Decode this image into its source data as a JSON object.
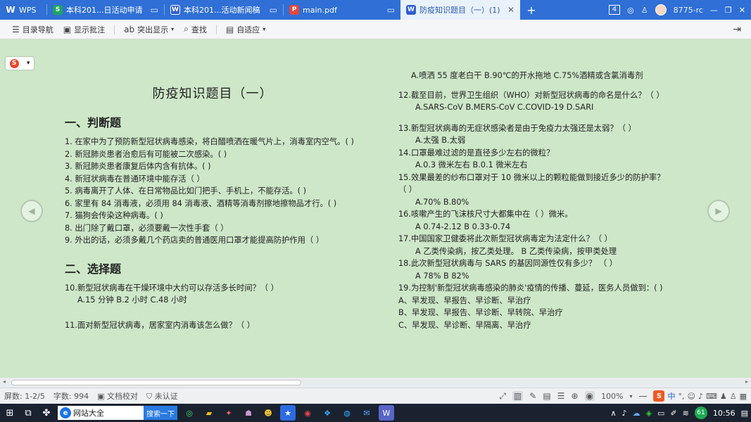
{
  "tabs": [
    {
      "label": "WPS",
      "icon": "wps-logo-icon",
      "color": "#ffffff"
    },
    {
      "label": "本科201...日活动申请",
      "icon": "spreadsheet-icon",
      "color": "#1fa462"
    },
    {
      "label": "本科201...活动新闻稿",
      "icon": "word-doc-icon",
      "color": "#2f5fd0"
    },
    {
      "label": "main.pdf",
      "icon": "pdf-icon",
      "color": "#e5483b"
    },
    {
      "label": "防疫知识题目（一）(1)",
      "icon": "word-doc-icon",
      "color": "#2f5fd0",
      "active": true
    }
  ],
  "titlebar": {
    "tab_count": "4",
    "user": "8775-rc",
    "new_tab": "+"
  },
  "toolbar": {
    "toc": "目录导航",
    "comments": "显示批注",
    "highlight": "突出显示",
    "find": "查找",
    "fit": "自适应"
  },
  "doc": {
    "title": "防疫知识题目（一）",
    "left": [
      {
        "type": "sec",
        "text": "一、判断题"
      },
      {
        "type": "wrap",
        "text": "1.  在家中为了预防新型冠状病毒感染，将白醋喷洒在暖气片上，消毒室内空气。(    )"
      },
      {
        "type": "ln",
        "text": "2.  新冠肺炎患者治愈后有可能被二次感染。(    )"
      },
      {
        "type": "ln",
        "text": "3.  新冠肺炎患者康复后体内含有抗体。(    )"
      },
      {
        "type": "ln",
        "text": "4.  新冠状病毒在普通环境中能存活（    ）"
      },
      {
        "type": "ln",
        "text": "5.  病毒离开了人体、在日常物品比如门把手、手机上，不能存活。(    )"
      },
      {
        "type": "ln",
        "text": "6.  家里有 84 消毒液，必须用 84 消毒液、酒精等消毒剂擦地擦物品才行。(    )"
      },
      {
        "type": "ln",
        "text": "7.  猫狗会传染这种病毒。(    )"
      },
      {
        "type": "ln",
        "text": "8.  出门除了戴口罩，必须要戴一次性手套（    ）"
      },
      {
        "type": "ln",
        "text": "9.  外出的话，必须多戴几个药店卖的普通医用口罩才能提高防护作用（    ）"
      },
      {
        "type": "sec",
        "text": "二、选择题"
      },
      {
        "type": "ln",
        "text": "10.新型冠状病毒在干燥环境中大约可以存活多长时间？（    ）"
      },
      {
        "type": "ind",
        "text": "A.15 分钟  B.2 小时  C.48 小时"
      },
      {
        "type": "ln",
        "text": "11.面对新型冠状病毒，居家室内消毒该怎么做？（    ）"
      }
    ],
    "right": [
      {
        "type": "ind",
        "text": "A.喷洒 55 度老白干  B.90℃的开水拖地  C.75%酒精或含氯消毒剂"
      },
      {
        "type": "ln",
        "text": "12.截至目前，世界卫生组织（WHO）对新型冠状病毒的命名是什么？（    ）"
      },
      {
        "type": "ind2",
        "text": "A.SARS-CoV B.MERS-CoV C.COVID-19 D.SARI"
      },
      {
        "type": "ln",
        "text": "13.新型冠状病毒的无症状感染者是由于免疫力太强还是太弱？（    ）"
      },
      {
        "type": "ind2",
        "text": "A.太强      B.太弱"
      },
      {
        "type": "ln",
        "text": "14.口罩最难过滤的是直径多少左右的微粒？"
      },
      {
        "type": "ind2",
        "text": "A.0.3 微米左右        B.0.1 微米左右"
      },
      {
        "type": "ln",
        "text": "15.效果最差的纱布口罩对于 10 微米以上的颗粒能做到接近多少的防护率？"
      },
      {
        "type": "ln",
        "text": "（    ）"
      },
      {
        "type": "ind2",
        "text": "A.70%    B.80%"
      },
      {
        "type": "ln",
        "text": "16.咳嗽产生的飞沫核尺寸大都集中在（    ）微米。"
      },
      {
        "type": "ind2",
        "text": "A      0.74-2.12          B      0.33-0.74"
      },
      {
        "type": "ln",
        "text": "17.中国国家卫健委将此次新型冠状病毒定为法定什么？（    ）"
      },
      {
        "type": "ind2",
        "text": "A    乙类传染病，按乙类处理。  B  乙类传染病，按甲类处理"
      },
      {
        "type": "ln",
        "text": "18.此次新型冠状病毒与 SARS 的基因同源性仅有多少？    （    ）"
      },
      {
        "type": "ind2",
        "text": "A     78%           B      82%"
      },
      {
        "type": "ln",
        "text": "19.为控制'新型冠状病毒感染的肺炎'疫情的传播、蔓延，医务人员做到：(    )"
      },
      {
        "type": "ln",
        "text": "A、早发现、早报告、早诊断、早治疗"
      },
      {
        "type": "ln",
        "text": "B、早发现、早报告、早诊断、早转院、早治疗"
      },
      {
        "type": "ln",
        "text": "C、早发现、早诊断、早隔离、早治疗"
      }
    ]
  },
  "status": {
    "pages": "屏数: 1-2/5",
    "words": "字数: 994",
    "proof": "文档校对",
    "cert": "未认证",
    "zoom": "100%",
    "ime_lang": "中"
  },
  "taskbar": {
    "browser_label": "网站大全",
    "search_label": "搜索一下",
    "time": "10:56",
    "badge": "61"
  }
}
